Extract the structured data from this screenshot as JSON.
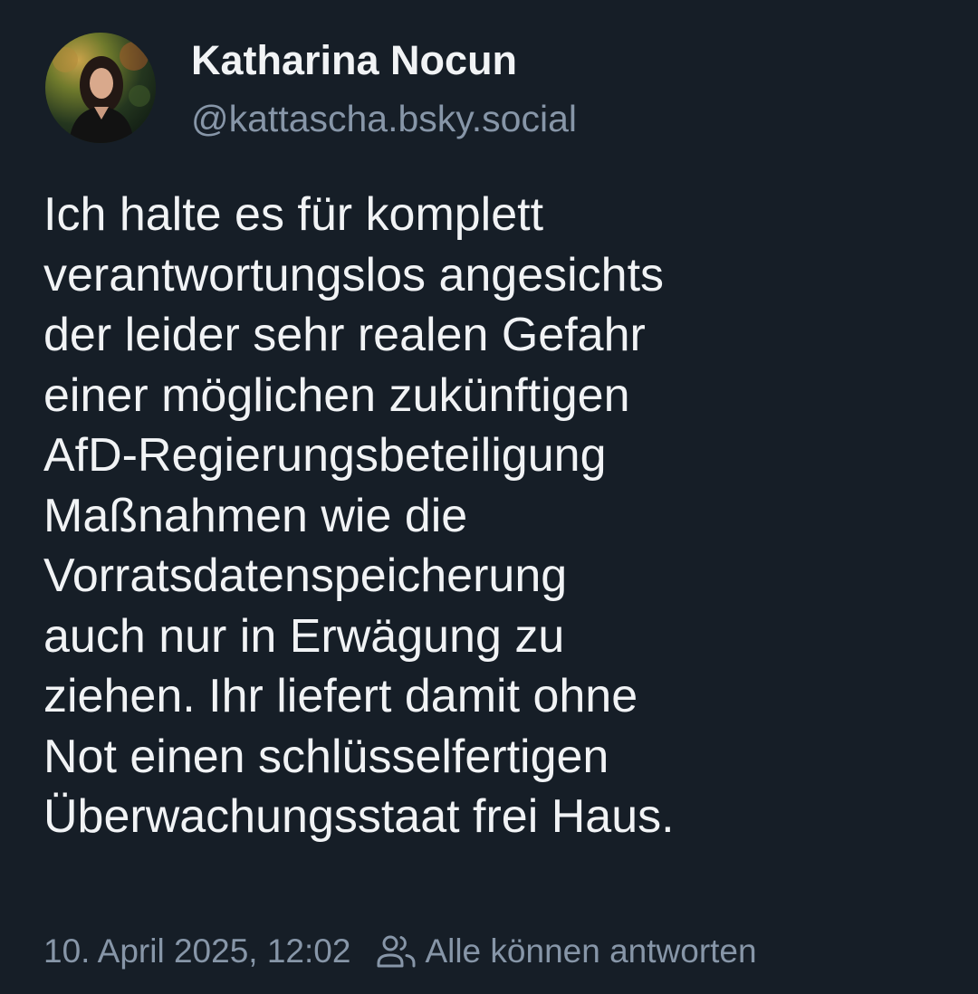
{
  "author": {
    "display_name": "Katharina Nocun",
    "handle": "@kattascha.bsky.social"
  },
  "post": {
    "lines": [
      "Ich halte es für komplett",
      "verantwortungslos angesichts",
      "der leider sehr realen Gefahr",
      "einer möglichen zukünftigen",
      "AfD-Regierungsbeteiligung",
      "Maßnahmen wie die",
      "Vorratsdatenspeicherung",
      "auch nur in Erwägung zu",
      "ziehen. Ihr liefert damit ohne",
      "Not einen schlüsselfertigen",
      "Überwachungsstaat frei Haus."
    ]
  },
  "meta": {
    "timestamp": "10. April 2025, 12:02",
    "reply_setting_label": "Alle können antworten",
    "reply_setting_icon": "people-icon"
  },
  "colors": {
    "background": "#161e27",
    "text": "#f1f3f5",
    "muted": "#8796a8"
  }
}
